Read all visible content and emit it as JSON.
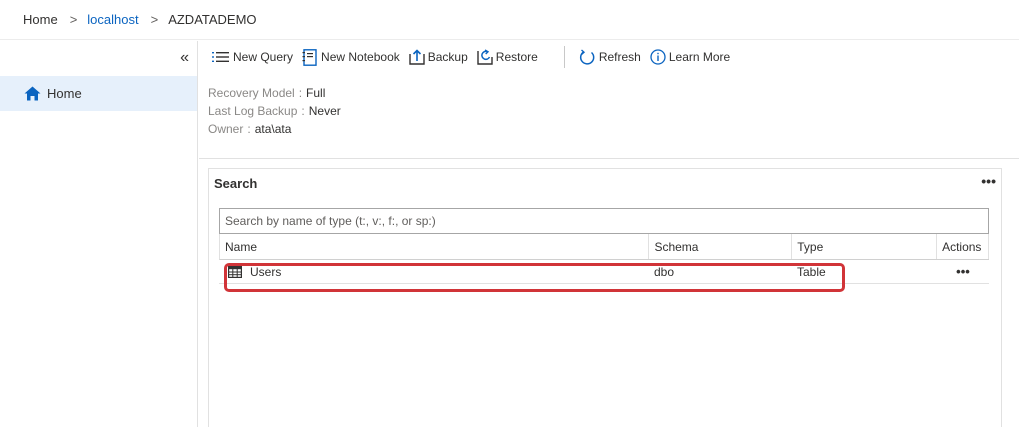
{
  "breadcrumb": {
    "items": [
      "Home",
      "localhost",
      "AZDATADEMO"
    ],
    "separator": ">"
  },
  "sidebar": {
    "collapse_glyph": "«",
    "items": [
      {
        "label": "Home",
        "icon": "home-icon"
      }
    ]
  },
  "toolbar": {
    "new_query": "New Query",
    "new_notebook": "New Notebook",
    "backup": "Backup",
    "restore": "Restore",
    "refresh": "Refresh",
    "learn_more": "Learn More"
  },
  "properties": [
    {
      "key": "Recovery Model",
      "value": "Full"
    },
    {
      "key": "Last Log Backup",
      "value": "Never"
    },
    {
      "key": "Owner",
      "value": "ata\\ata"
    }
  ],
  "search": {
    "title": "Search",
    "more_glyph": "•••",
    "placeholder": "Search by name of type (t:, v:, f:, or sp:)",
    "columns": [
      "Name",
      "Schema",
      "Type",
      "Actions"
    ],
    "rows": [
      {
        "name": "Users",
        "schema": "dbo",
        "type": "Table",
        "actions": "•••"
      }
    ]
  },
  "colors": {
    "accent": "#0b64c0",
    "selected_bg": "#e6f0fb",
    "highlight_border": "#d13438"
  }
}
